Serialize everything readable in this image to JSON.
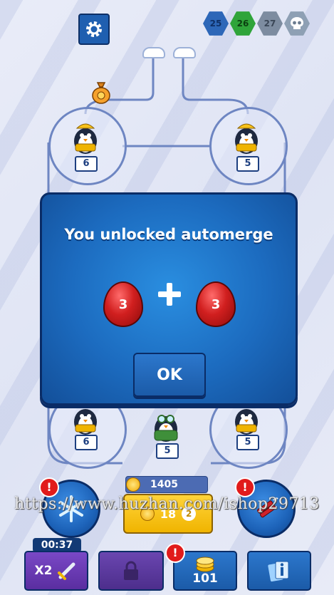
{
  "top_bar": {
    "settings_icon": "gear-icon",
    "levels": [
      {
        "label": "25",
        "state": "completed",
        "color": "#2d67b8"
      },
      {
        "label": "26",
        "state": "current",
        "color": "#2fa43a"
      },
      {
        "label": "27",
        "state": "locked",
        "color": "#7d8ca0"
      }
    ],
    "boss_icon": "skull-icon"
  },
  "board": {
    "slots": [
      {
        "id": "top-left",
        "level": "6",
        "unit": "penguin-builder"
      },
      {
        "id": "top-right",
        "level": "5",
        "unit": "penguin-builder"
      },
      {
        "id": "bottom-left",
        "level": "6",
        "unit": "penguin-builder"
      },
      {
        "id": "bottom-center",
        "level": "5",
        "unit": "penguin-pilot"
      },
      {
        "id": "bottom-right",
        "level": "5",
        "unit": "penguin-builder"
      }
    ],
    "reward_icon": "money-bag-icon"
  },
  "dialog": {
    "title": "You unlocked automerge",
    "left_egg": "3",
    "right_egg": "3",
    "plus_icon": "plus-icon",
    "ok_label": "OK"
  },
  "bottom": {
    "coins": "1405",
    "buy_cost": "18",
    "buy_badge": "2",
    "freeze_icon": "snowflake-icon",
    "dynamite_icon": "dynamite-icon",
    "timer": "00:37",
    "boost_label": "X2",
    "coin_shop_value": "101",
    "info_icon": "info-cards-icon",
    "lock_icon": "lock-icon",
    "alert_mark": "!"
  },
  "watermark": "https://www.huzhan.com/ishop29713",
  "colors": {
    "dialog_blue": "#1c6bbf",
    "egg_red": "#d11f1f",
    "coin_gold": "#f0b400",
    "accent_navy": "#0a2c66"
  }
}
